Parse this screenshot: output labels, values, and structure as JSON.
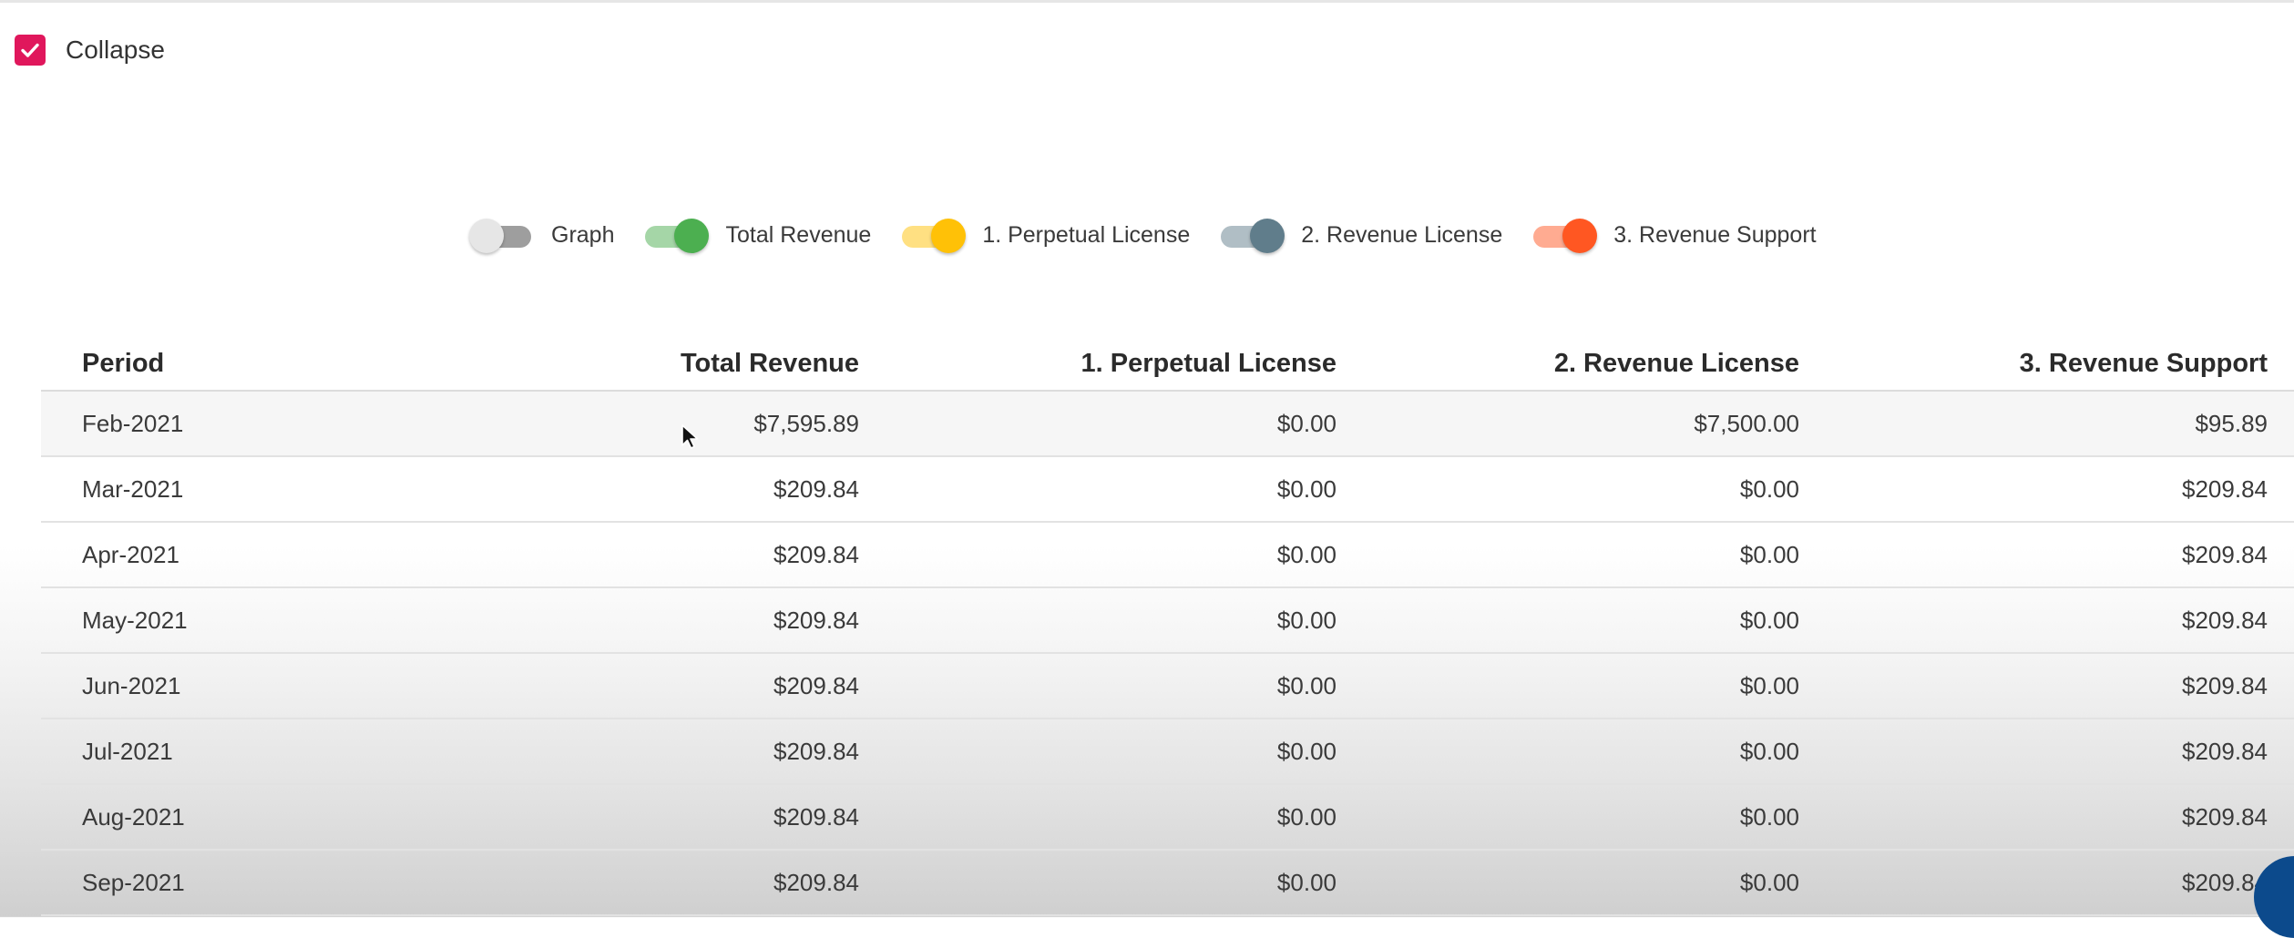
{
  "collapse": {
    "label": "Collapse",
    "checked": true,
    "color": "#e0175c"
  },
  "legend": [
    {
      "label": "Graph",
      "on": false,
      "track_color": "#9e9e9e",
      "knob_color": "#e6e6e6"
    },
    {
      "label": "Total Revenue",
      "on": true,
      "track_color": "#a5d6a7",
      "knob_color": "#4caf50"
    },
    {
      "label": "1. Perpetual License",
      "on": true,
      "track_color": "#ffe082",
      "knob_color": "#ffc107"
    },
    {
      "label": "2. Revenue License",
      "on": true,
      "track_color": "#b0bec5",
      "knob_color": "#607d8b"
    },
    {
      "label": "3. Revenue Support",
      "on": true,
      "track_color": "#ffab91",
      "knob_color": "#ff5722"
    }
  ],
  "table": {
    "headers": [
      "Period",
      "Total Revenue",
      "1. Perpetual License",
      "2. Revenue License",
      "3. Revenue Support"
    ],
    "rows": [
      [
        "Feb-2021",
        "$7,595.89",
        "$0.00",
        "$7,500.00",
        "$95.89"
      ],
      [
        "Mar-2021",
        "$209.84",
        "$0.00",
        "$0.00",
        "$209.84"
      ],
      [
        "Apr-2021",
        "$209.84",
        "$0.00",
        "$0.00",
        "$209.84"
      ],
      [
        "May-2021",
        "$209.84",
        "$0.00",
        "$0.00",
        "$209.84"
      ],
      [
        "Jun-2021",
        "$209.84",
        "$0.00",
        "$0.00",
        "$209.84"
      ],
      [
        "Jul-2021",
        "$209.84",
        "$0.00",
        "$0.00",
        "$209.84"
      ],
      [
        "Aug-2021",
        "$209.84",
        "$0.00",
        "$0.00",
        "$209.84"
      ],
      [
        "Sep-2021",
        "$209.84",
        "$0.00",
        "$0.00",
        "$209.84"
      ]
    ]
  }
}
